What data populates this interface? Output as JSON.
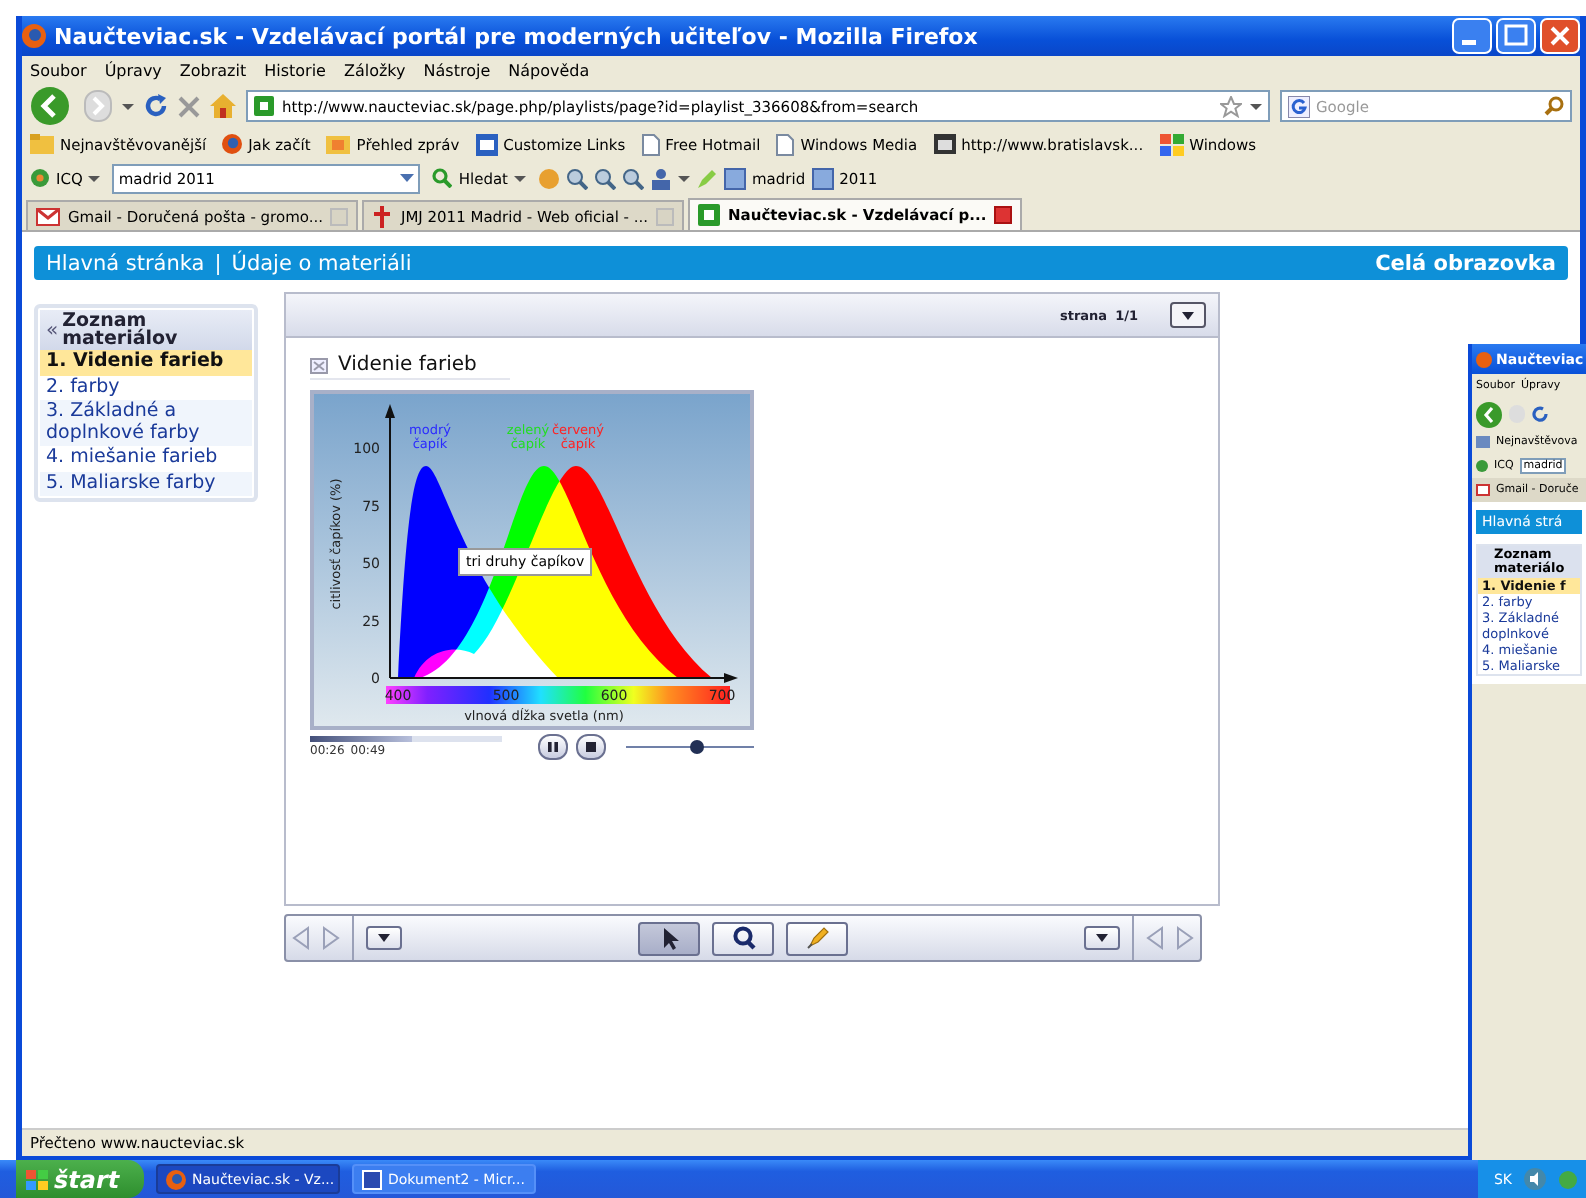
{
  "window": {
    "title": "Naučteviac.sk - Vzdelávací portál pre moderných učiteľov - Mozilla Firefox"
  },
  "menu": [
    "Soubor",
    "Úpravy",
    "Zobrazit",
    "Historie",
    "Záložky",
    "Nástroje",
    "Nápověda"
  ],
  "navigation": {
    "url": "http://www.naucteviac.sk/page.php/playlists/page?id=playlist_336608&from=search",
    "search_placeholder": "Google"
  },
  "bookmarks": [
    {
      "label": "Nejnavštěvovanější",
      "kind": "folder"
    },
    {
      "label": "Jak začít",
      "kind": "firefox"
    },
    {
      "label": "Přehled zpráv",
      "kind": "feed"
    },
    {
      "label": "Customize Links",
      "kind": "links"
    },
    {
      "label": "Free Hotmail",
      "kind": "page"
    },
    {
      "label": "Windows Media",
      "kind": "page"
    },
    {
      "label": "http://www.bratislavsk...",
      "kind": "calendar"
    },
    {
      "label": "Windows",
      "kind": "windows"
    }
  ],
  "icq_toolbar": {
    "label": "ICQ",
    "search_value": "madrid 2011",
    "search_button": "Hledat",
    "items": [
      "madrid",
      "2011"
    ]
  },
  "tabs": [
    {
      "label": "Gmail - Doručená pošta - gromo...",
      "kind": "gmail",
      "selected": false
    },
    {
      "label": "JMJ 2011 Madrid - Web oficial - ...",
      "kind": "jmj",
      "selected": false
    },
    {
      "label": "Naučteviac.sk - Vzdelávací p...",
      "kind": "site",
      "selected": true
    }
  ],
  "page": {
    "breadcrumb": [
      "Hlavná stránka",
      "Údaje o materiáli"
    ],
    "breadcrumb_separator": "|",
    "fullscreen_link": "Celá obrazovka"
  },
  "sidebar": {
    "collapse_glyph": "«",
    "title": "Zoznam materiálov",
    "items": [
      {
        "label": "1. Videnie farieb",
        "selected": true
      },
      {
        "label": "2. farby",
        "selected": false
      },
      {
        "label": "3. Základné a doplnkové farby",
        "selected": false
      },
      {
        "label": "4. miešanie farieb",
        "selected": false
      },
      {
        "label": "5. Maliarske farby",
        "selected": false
      }
    ]
  },
  "player": {
    "page_label": "strana",
    "page_value": "1/1",
    "slide_title": "Videnie farieb",
    "figure": {
      "curve_labels": [
        {
          "lines": [
            "modrý",
            "čapík"
          ],
          "color": "#2a2aff"
        },
        {
          "lines": [
            "zelený",
            "čapík"
          ],
          "color": "#22dd22"
        },
        {
          "lines": [
            "červený",
            "čapík"
          ],
          "color": "#ff2222"
        }
      ],
      "y_ticks": [
        "100",
        "75",
        "50",
        "25",
        "0"
      ],
      "x_ticks": [
        "400",
        "500",
        "600",
        "700"
      ],
      "ylabel": "citlivosť čapíkov (%)",
      "xlabel": "vlnová dĺžka svetla (nm)",
      "tooltip": "tri druhy čapíkov"
    },
    "elapsed": "00:26",
    "duration": "00:49",
    "progress": {
      "level": 0.53
    },
    "volume": {
      "level": 0.55
    },
    "tools": [
      {
        "kind": "pointer",
        "selected": true
      },
      {
        "kind": "zoom",
        "selected": false
      },
      {
        "kind": "pen",
        "selected": false
      }
    ]
  },
  "status_bar": "Přečteno www.naucteviac.sk",
  "taskbar": {
    "start": "štart",
    "tasks": [
      {
        "label": "Naučteviac.sk - Vz...",
        "kind": "firefox",
        "selected": true
      },
      {
        "label": "Dokument2 - Micr...",
        "kind": "word",
        "selected": false
      }
    ],
    "language": "SK"
  },
  "background_window": {
    "title": "Naučteviac",
    "menu": [
      "Soubor",
      "Úpravy"
    ],
    "bookmark": "Nejnavštěvova",
    "icq": "ICQ",
    "search_value": "madrid",
    "tab": "Gmail - Doruče",
    "header": "Hlavná strá",
    "sidebar_title": [
      "Zoznam",
      "materiálo"
    ],
    "sidebar_items": [
      {
        "label": "1. Videnie f",
        "selected": true
      },
      {
        "label": "2. farby",
        "selected": false
      },
      {
        "label": "3. Základné",
        "selected": false
      },
      {
        "label": "doplnkové",
        "selected": false
      },
      {
        "label": "4. miešanie",
        "selected": false
      },
      {
        "label": "5. Maliarske",
        "selected": false
      }
    ]
  }
}
